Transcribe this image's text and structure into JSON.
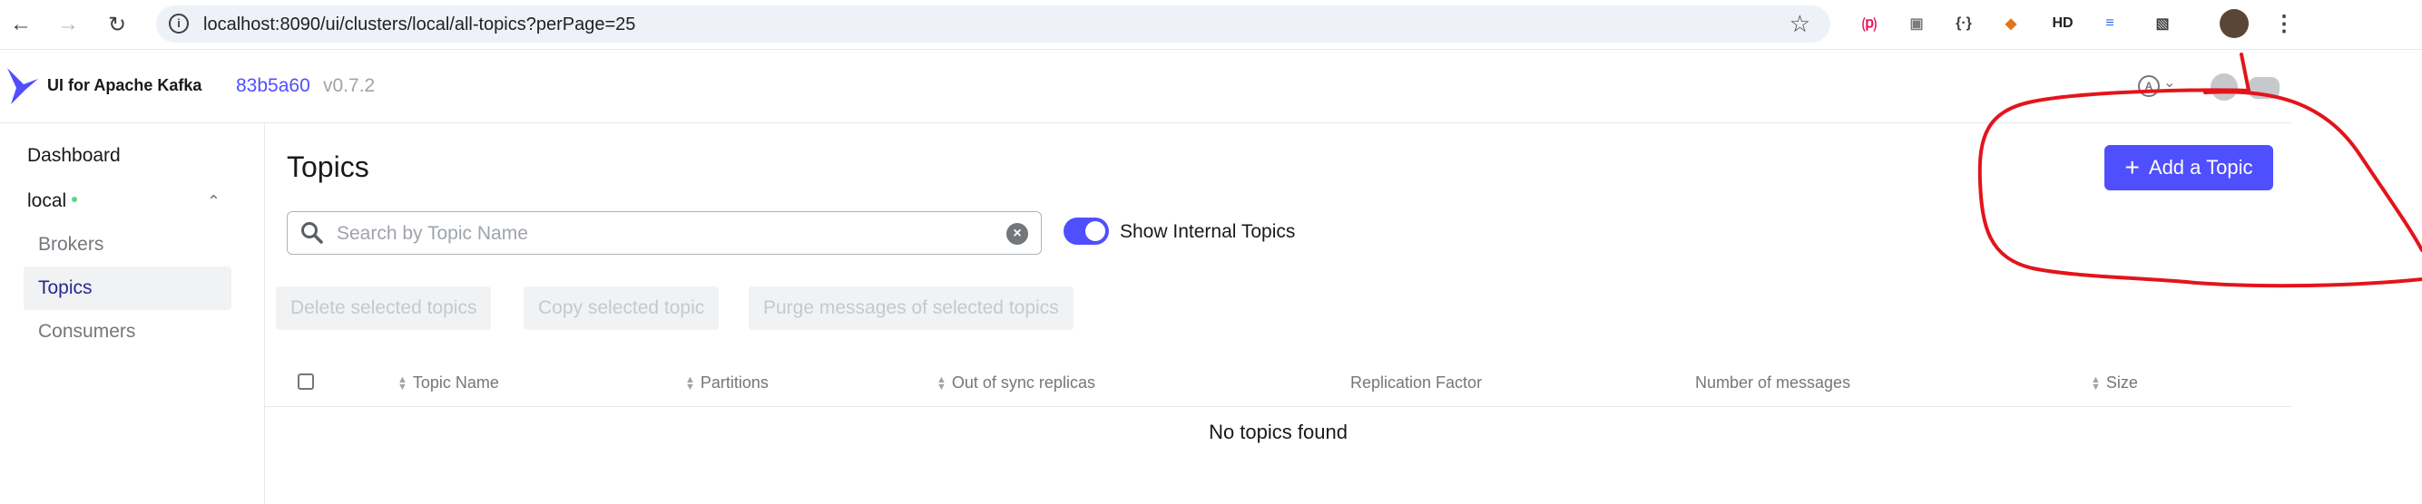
{
  "browser": {
    "url": "localhost:8090/ui/clusters/local/all-topics?perPage=25",
    "extensions": [
      {
        "name": "pin-icon",
        "glyph": "⒫",
        "color": "#e8175d"
      },
      {
        "name": "camera-icon",
        "glyph": "▣",
        "color": "#7a7d80"
      },
      {
        "name": "brackets-icon",
        "glyph": "{·}",
        "color": "#3c4043"
      },
      {
        "name": "fox-icon",
        "glyph": "◆",
        "color": "#e2761b"
      },
      {
        "name": "hd-icon",
        "glyph": "HD",
        "color": "#202124"
      },
      {
        "name": "stack-icon",
        "glyph": "≡",
        "color": "#3367d6"
      },
      {
        "name": "puzzle-icon",
        "glyph": "▧",
        "color": "#3c4043"
      }
    ]
  },
  "header": {
    "brand": "UI for Apache Kafka",
    "commit": "83b5a60",
    "version": "v0.7.2",
    "user_initial": "A"
  },
  "sidebar": {
    "dashboard": "Dashboard",
    "cluster": "local",
    "items": [
      {
        "label": "Brokers"
      },
      {
        "label": "Topics"
      },
      {
        "label": "Consumers"
      }
    ]
  },
  "main": {
    "title": "Topics",
    "add_button": "Add a Topic",
    "search_placeholder": "Search by Topic Name",
    "toggle_label": "Show Internal Topics",
    "bulk_actions": [
      "Delete selected topics",
      "Copy selected topic",
      "Purge messages of selected topics"
    ],
    "columns": [
      "Topic Name",
      "Partitions",
      "Out of sync replicas",
      "Replication Factor",
      "Number of messages",
      "Size"
    ],
    "empty_message": "No topics found"
  },
  "colors": {
    "accent": "#4f4ffe",
    "annotation": "#e3141b"
  }
}
